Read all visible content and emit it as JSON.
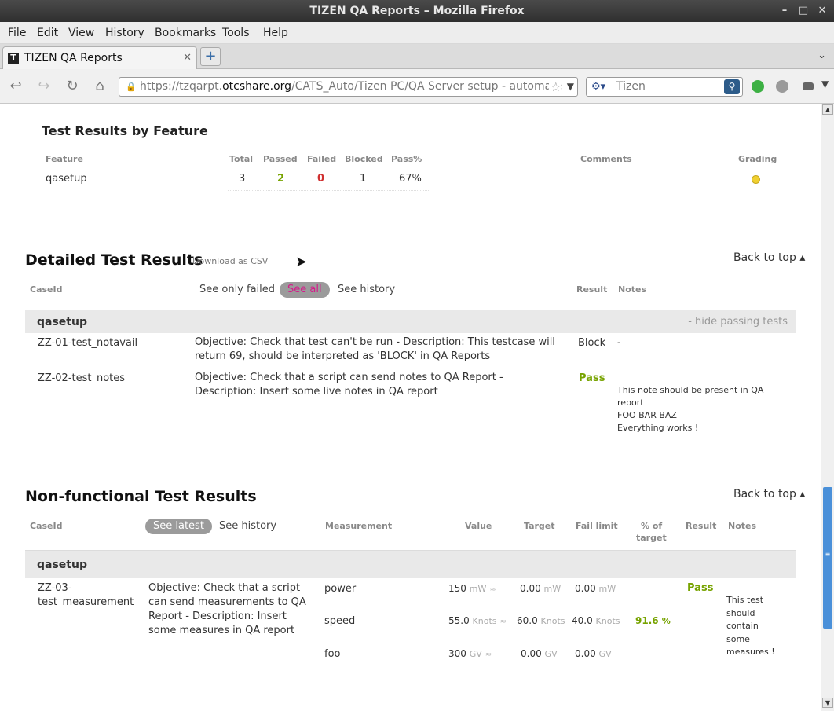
{
  "window": {
    "title": "TIZEN QA Reports – Mozilla Firefox",
    "minimize": "–",
    "maximize": "□",
    "close": "✕"
  },
  "menu": [
    "File",
    "Edit",
    "View",
    "History",
    "Bookmarks",
    "Tools",
    "Help"
  ],
  "tab": {
    "favicon": "T",
    "title": "TIZEN QA Reports",
    "close": "✕",
    "newtab": "+",
    "list": "⌄"
  },
  "nav": {
    "url_prefix": "https://tzqarpt.",
    "url_host": "otcshare.org",
    "url_path": "/CATS_Auto/Tizen PC/QA Server setup - automate",
    "search_placeholder": "Tizen"
  },
  "feature_section": {
    "title": "Test Results by Feature",
    "headers": {
      "feature": "Feature",
      "total": "Total",
      "passed": "Passed",
      "failed": "Failed",
      "blocked": "Blocked",
      "pass_pct": "Pass%",
      "comments": "Comments",
      "grading": "Grading"
    },
    "row": {
      "feature": "qasetup",
      "total": "3",
      "passed": "2",
      "failed": "0",
      "blocked": "1",
      "pass_pct": "67%",
      "comments": "",
      "grading_color": "#f0d030"
    }
  },
  "detailed_section": {
    "title": "Detailed Test Results",
    "download_csv": "Download as CSV",
    "back_to_top": "Back to top ▴",
    "headers": {
      "caseid": "CaseId",
      "result": "Result",
      "notes": "Notes"
    },
    "filters": {
      "only_failed": "See only failed",
      "all": "See all",
      "history": "See history"
    },
    "group": "qasetup",
    "hide_passing": "- hide passing tests",
    "rows": [
      {
        "caseid": "ZZ-01-test_notavail",
        "description": "Objective: Check that test can't be run - Description: This testcase will return 69, should be interpreted as 'BLOCK' in QA Reports",
        "result": "Block",
        "notes": [
          "-"
        ]
      },
      {
        "caseid": "ZZ-02-test_notes",
        "description": "Objective: Check that a script can send notes to QA Report - Description: Insert some live notes in QA report",
        "result": "Pass",
        "notes": [
          "This note should be present in QA report",
          "FOO BAR BAZ",
          "Everything works !"
        ]
      }
    ]
  },
  "nft_section": {
    "title": "Non-functional Test Results",
    "back_to_top": "Back to top ▴",
    "headers": {
      "caseid": "CaseId",
      "measurement": "Measurement",
      "value": "Value",
      "target": "Target",
      "fail_limit": "Fail limit",
      "pct_target_1": "% of",
      "pct_target_2": "target",
      "result": "Result",
      "notes": "Notes"
    },
    "filters": {
      "latest": "See latest",
      "history": "See history"
    },
    "group": "qasetup",
    "caseid": "ZZ-03-test_measurement",
    "description": "Objective: Check that a script can send measurements to QA Report - Description: Insert some measures in QA report",
    "result": "Pass",
    "notes": "This test should contain some measures !",
    "measurements": [
      {
        "name": "power",
        "value": "150",
        "value_unit": "mW",
        "target": "0.00",
        "target_unit": "mW",
        "fail": "0.00",
        "fail_unit": "mW",
        "pct": "",
        "pct_unit": ""
      },
      {
        "name": "speed",
        "value": "55.0",
        "value_unit": "Knots",
        "target": "60.0",
        "target_unit": "Knots",
        "fail": "40.0",
        "fail_unit": "Knots",
        "pct": "91.6",
        "pct_unit": "%"
      },
      {
        "name": "foo",
        "value": "300",
        "value_unit": "GV",
        "target": "0.00",
        "target_unit": "GV",
        "fail": "0.00",
        "fail_unit": "GV",
        "pct": "",
        "pct_unit": ""
      }
    ]
  },
  "colors": {
    "pass": "#77a300",
    "fail": "#d03030",
    "see_all": "#d6198a",
    "pct_good": "#77a300"
  }
}
